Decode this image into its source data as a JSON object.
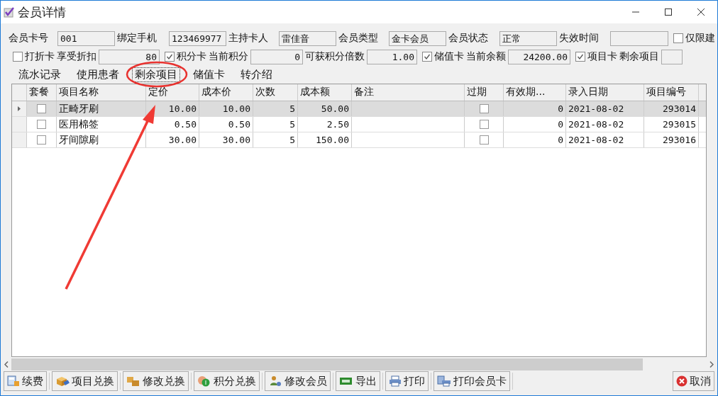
{
  "window": {
    "title": "会员详情"
  },
  "fields_row1": [
    {
      "label": "会员卡号",
      "value": "001"
    },
    {
      "label": "绑定手机",
      "value": "123469977"
    },
    {
      "label": "主持卡人",
      "value": "雷佳音"
    },
    {
      "label": "会员类型",
      "value": "金卡会员"
    },
    {
      "label": "会员状态",
      "value": "正常"
    },
    {
      "label": "失效时间"
    }
  ],
  "limit_checkbox": {
    "label": "仅限建",
    "checked": false
  },
  "cards": [
    {
      "card": "打折卡",
      "checked": false,
      "label": "享受折扣",
      "value": "80"
    },
    {
      "card": "积分卡",
      "checked": true,
      "label": "当前积分",
      "value": "0",
      "extra_label": "可获积分倍数",
      "extra_value": "1.00"
    },
    {
      "card": "储值卡",
      "checked": true,
      "label": "当前余额",
      "value": "24200.00"
    },
    {
      "card": "项目卡",
      "checked": true,
      "label": "剩余项目"
    }
  ],
  "tabs": [
    {
      "label": "流水记录",
      "selected": false
    },
    {
      "label": "使用患者",
      "selected": false
    },
    {
      "label": "剩余项目",
      "selected": true
    },
    {
      "label": "储值卡",
      "selected": false
    },
    {
      "label": "转介绍",
      "selected": false
    }
  ],
  "table": {
    "columns": [
      "套餐",
      "项目名称",
      "定价",
      "成本价",
      "次数",
      "成本额",
      "备注",
      "过期",
      "有效期...",
      "录入日期",
      "项目编号"
    ],
    "rows": [
      {
        "selected": true,
        "package": false,
        "name": "正畸牙刷",
        "price": "10.00",
        "cost": "10.00",
        "times": "5",
        "cost_total": "50.00",
        "expired": false,
        "validity": "0",
        "date": "2021-08-02",
        "code": "293014"
      },
      {
        "selected": false,
        "package": false,
        "name": "医用棉签",
        "price": "0.50",
        "cost": "0.50",
        "times": "5",
        "cost_total": "2.50",
        "expired": false,
        "validity": "0",
        "date": "2021-08-02",
        "code": "293015"
      },
      {
        "selected": false,
        "package": false,
        "name": "牙间隙刷",
        "price": "30.00",
        "cost": "30.00",
        "times": "5",
        "cost_total": "150.00",
        "expired": false,
        "validity": "0",
        "date": "2021-08-02",
        "code": "293016"
      }
    ]
  },
  "buttons": [
    {
      "label": "续费",
      "kind": "calculator"
    },
    {
      "label": "项目兑换",
      "kind": "box-tag"
    },
    {
      "label": "修改兑换",
      "kind": "boxes"
    },
    {
      "label": "积分兑换",
      "kind": "coins"
    },
    {
      "label": "修改会员",
      "kind": "user-gear"
    },
    {
      "label": "导出",
      "kind": "xls"
    },
    {
      "label": "打印",
      "kind": "printer"
    },
    {
      "label": "打印会员卡",
      "kind": "printer-card"
    }
  ],
  "cancel_button": {
    "label": "取消"
  }
}
